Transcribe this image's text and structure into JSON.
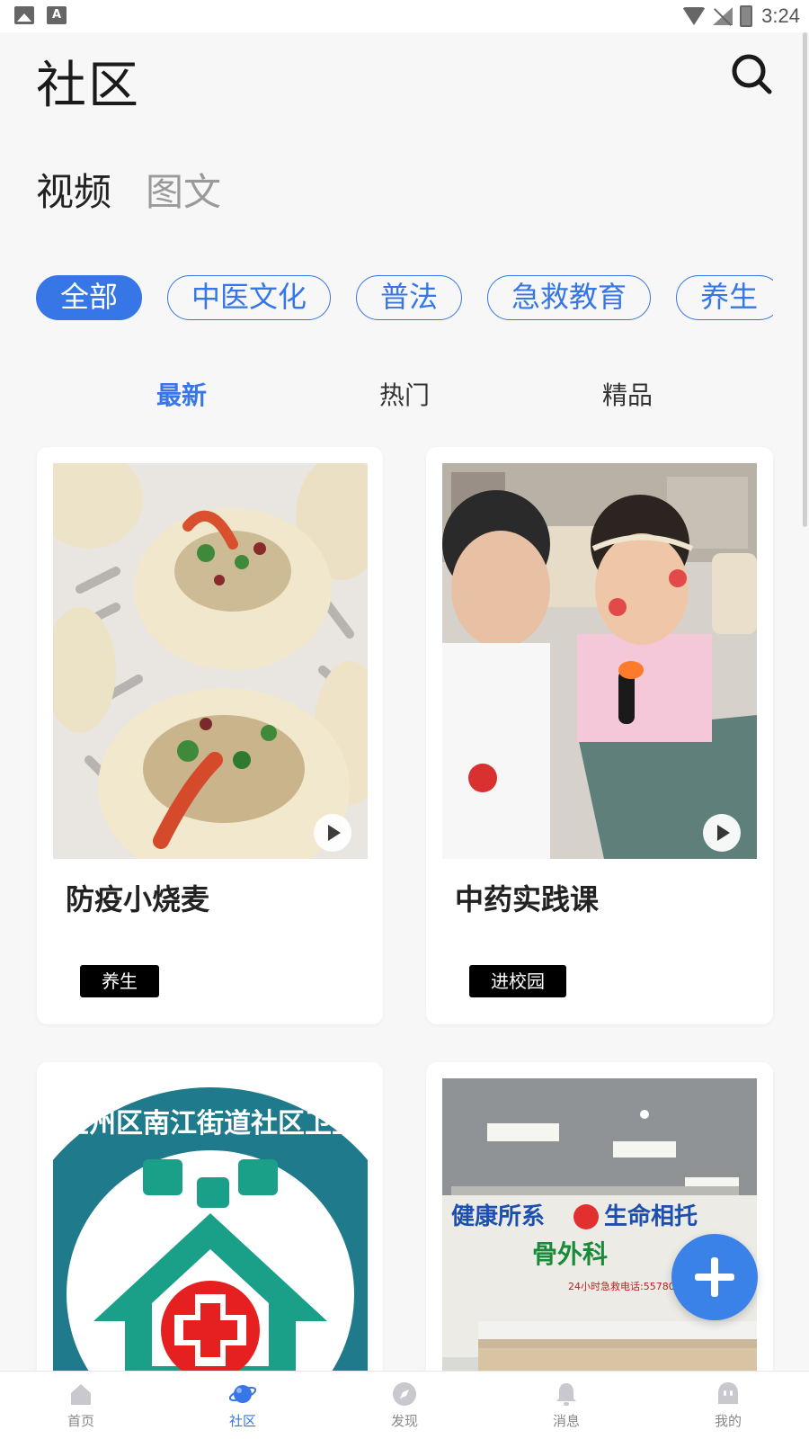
{
  "status_bar": {
    "time": "3:24",
    "left_icons": [
      "gallery-icon",
      "font-icon"
    ],
    "right_icons": [
      "wifi-icon",
      "no-signal-icon",
      "battery-icon"
    ]
  },
  "header": {
    "title": "社区",
    "search_icon": "search-icon"
  },
  "content_tabs": [
    {
      "label": "视频",
      "active": true
    },
    {
      "label": "图文",
      "active": false
    }
  ],
  "categories": [
    {
      "label": "全部",
      "active": true
    },
    {
      "label": "中医文化",
      "active": false
    },
    {
      "label": "普法",
      "active": false
    },
    {
      "label": "急救教育",
      "active": false
    },
    {
      "label": "养生",
      "active": false
    }
  ],
  "sort_tabs": [
    {
      "label": "最新",
      "active": true
    },
    {
      "label": "热门",
      "active": false
    },
    {
      "label": "精品",
      "active": false
    }
  ],
  "cards": [
    {
      "title": "防疫小烧麦",
      "tag": "养生",
      "thumbnail": "dumplings-photo",
      "has_video": true
    },
    {
      "title": "中药实践课",
      "tag": "进校园",
      "thumbnail": "children-photo",
      "has_video": true
    },
    {
      "title": "",
      "tag": "",
      "thumbnail": "health-center-logo",
      "has_video": false
    },
    {
      "title": "",
      "tag": "",
      "thumbnail": "clinic-reception-photo",
      "has_video": false
    }
  ],
  "card3_logo": {
    "ring_text": "市玉州区南江街道社区卫生服"
  },
  "card4_sign": {
    "line1": "健康所系",
    "line2": "生命相托",
    "line3": "骨外科",
    "line4": "24小时急救电话:5578060"
  },
  "fab": {
    "icon": "plus-icon"
  },
  "bottom_nav": [
    {
      "label": "首页",
      "icon": "home-icon",
      "active": false
    },
    {
      "label": "社区",
      "icon": "planet-icon",
      "active": true
    },
    {
      "label": "发现",
      "icon": "compass-icon",
      "active": false
    },
    {
      "label": "消息",
      "icon": "bell-icon",
      "active": false
    },
    {
      "label": "我的",
      "icon": "profile-icon",
      "active": false
    }
  ],
  "colors": {
    "accent": "#3776e6",
    "background": "#f7f7f8",
    "tag_bg": "#000000"
  }
}
